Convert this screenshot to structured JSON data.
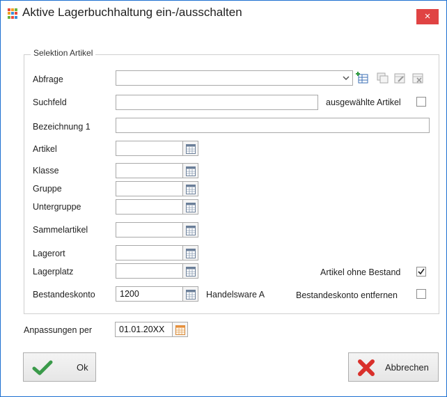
{
  "window": {
    "title": "Aktive Lagerbuchhaltung ein-/ausschalten",
    "close_glyph": "×",
    "icon": "app-grid-icon"
  },
  "selection": {
    "legend": "Selektion Artikel",
    "abfrage_label": "Abfrage",
    "abfrage_value": "",
    "suchfeld_label": "Suchfeld",
    "suchfeld_value": "",
    "ausgewaehlte_label": "ausgewählte Artikel",
    "ausgewaehlte_checked": false,
    "bezeichnung_label": "Bezeichnung 1",
    "bezeichnung_value": "",
    "artikel_label": "Artikel",
    "artikel_value": "",
    "klasse_label": "Klasse",
    "klasse_value": "",
    "gruppe_label": "Gruppe",
    "gruppe_value": "",
    "untergruppe_label": "Untergruppe",
    "untergruppe_value": "",
    "sammelartikel_label": "Sammelartikel",
    "sammelartikel_value": "",
    "lagerort_label": "Lagerort",
    "lagerort_value": "",
    "lagerplatz_label": "Lagerplatz",
    "lagerplatz_value": "",
    "ohne_bestand_label": "Artikel ohne Bestand",
    "ohne_bestand_checked": true,
    "bestandeskonto_label": "Bestandeskonto",
    "bestandeskonto_value": "1200",
    "bestandeskonto_desc": "Handelsware A",
    "konto_entfernen_label": "Bestandeskonto entfernen",
    "konto_entfernen_checked": false
  },
  "adjust": {
    "label": "Anpassungen per",
    "date_value": "01.01.20XX"
  },
  "buttons": {
    "ok_label": "Ok",
    "cancel_label": "Abbrechen"
  },
  "colors": {
    "accent": "#1c6fd1",
    "close_bg": "#e04343",
    "ok_check": "#3a9a4a",
    "cancel_x": "#d9302b"
  }
}
